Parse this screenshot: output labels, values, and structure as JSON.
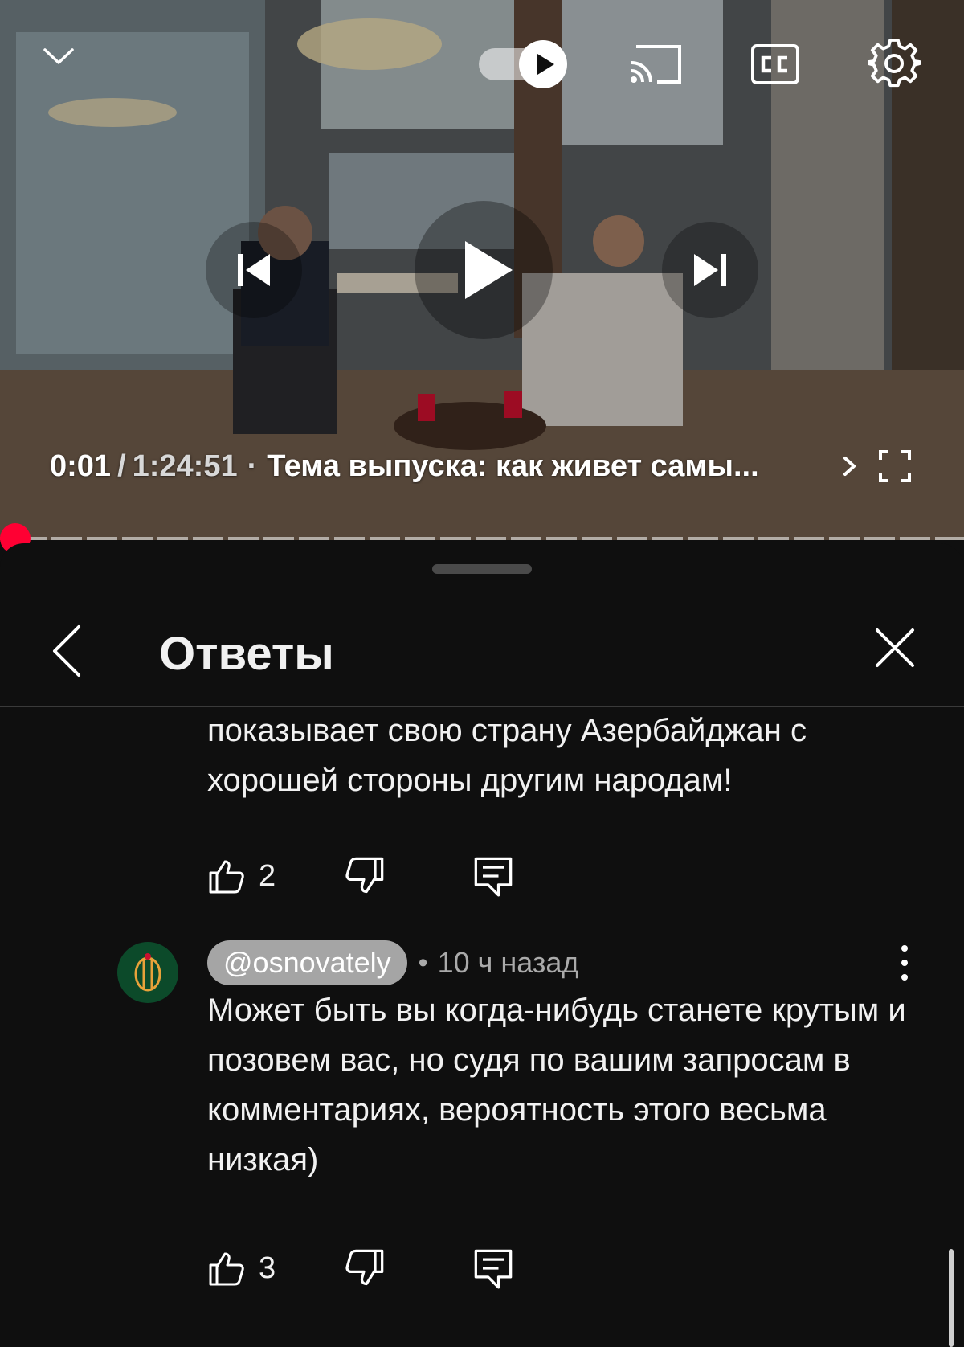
{
  "player": {
    "time_current": "0:01",
    "time_separator": "/",
    "time_total": "1:24:51",
    "chapter_separator": "·",
    "chapter_title": "Тема выпуска: как живет самы...",
    "progress_fraction": 0.0002,
    "accent_color": "#ff0033",
    "icons": [
      "chevron-down-icon",
      "autoplay-toggle",
      "cast-icon",
      "cc-icon",
      "gear-icon",
      "previous-icon",
      "play-icon",
      "next-icon",
      "chevron-right-icon",
      "fullscreen-icon"
    ]
  },
  "replies_panel": {
    "title": "Ответы",
    "icons": [
      "back-arrow-icon",
      "close-icon"
    ]
  },
  "comments": [
    {
      "text": "успеха, грамотный,образованный парень и показывает свою страну Азербайджан с хорошей стороны другим народам!",
      "likes": "2"
    },
    {
      "author": "@osnovately",
      "meta_separator": "•",
      "time": "10 ч назад",
      "text": "Может быть вы когда-нибудь станете крутым и позовем вас, но судя по вашим запросам в комментариях, вероятность этого весьма низкая)",
      "likes": "3"
    }
  ]
}
